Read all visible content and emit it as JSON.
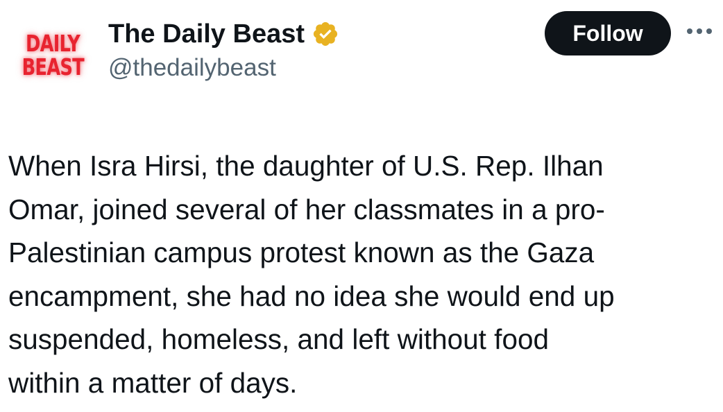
{
  "author": {
    "avatar_logo_lines": [
      "DAILY",
      "BEAST"
    ],
    "display_name": "The Daily Beast",
    "handle": "@thedailybeast",
    "verified_badge": "gold-checkmark-icon",
    "verified_color": "#e8b222"
  },
  "actions": {
    "follow_label": "Follow",
    "more_icon": "more-horizontal-icon"
  },
  "tweet": {
    "lines": [
      "When Isra Hirsi, the daughter of U.S. Rep. Ilhan",
      "Omar, joined several of her classmates in a pro-",
      "Palestinian campus protest known as the Gaza",
      "encampment, she had no idea she would end up",
      "suspended, homeless, and left without food",
      "within a matter of days."
    ]
  },
  "colors": {
    "brand_red": "#e8232f",
    "text_primary": "#0f1419",
    "text_secondary": "#536471",
    "button_bg": "#0f1419"
  }
}
